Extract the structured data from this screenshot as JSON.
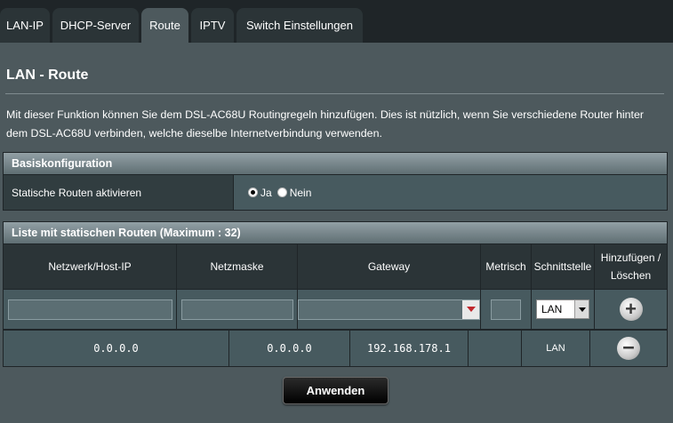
{
  "tabs": [
    {
      "label": "LAN-IP",
      "active": false
    },
    {
      "label": "DHCP-Server",
      "active": false
    },
    {
      "label": "Route",
      "active": true
    },
    {
      "label": "IPTV",
      "active": false
    },
    {
      "label": "Switch Einstellungen",
      "active": false
    }
  ],
  "page": {
    "title": "LAN - Route",
    "description": "Mit dieser Funktion können Sie dem DSL-AC68U Routingregeln hinzufügen. Dies ist nützlich, wenn Sie verschiedene Router hinter dem DSL-AC68U verbinden, welche dieselbe Internetverbindung verwenden."
  },
  "basis": {
    "header": "Basiskonfiguration",
    "row_label": "Statische Routen aktivieren",
    "option_yes": "Ja",
    "option_no": "Nein",
    "selected": "Ja"
  },
  "routes": {
    "header": "Liste mit statischen Routen (Maximum : 32)",
    "columns": {
      "network": "Netzwerk/Host-IP",
      "netmask": "Netzmaske",
      "gateway": "Gateway",
      "metric": "Metrisch",
      "interface": "Schnittstelle",
      "add_delete": "Hinzufügen / Löschen"
    },
    "input_interface": "LAN",
    "rows": [
      {
        "network": "0.0.0.0",
        "netmask": "0.0.0.0",
        "gateway": "192.168.178.1",
        "metric": "",
        "interface": "LAN"
      }
    ]
  },
  "actions": {
    "apply": "Anwenden",
    "add_symbol": "+",
    "delete_symbol": "−"
  }
}
